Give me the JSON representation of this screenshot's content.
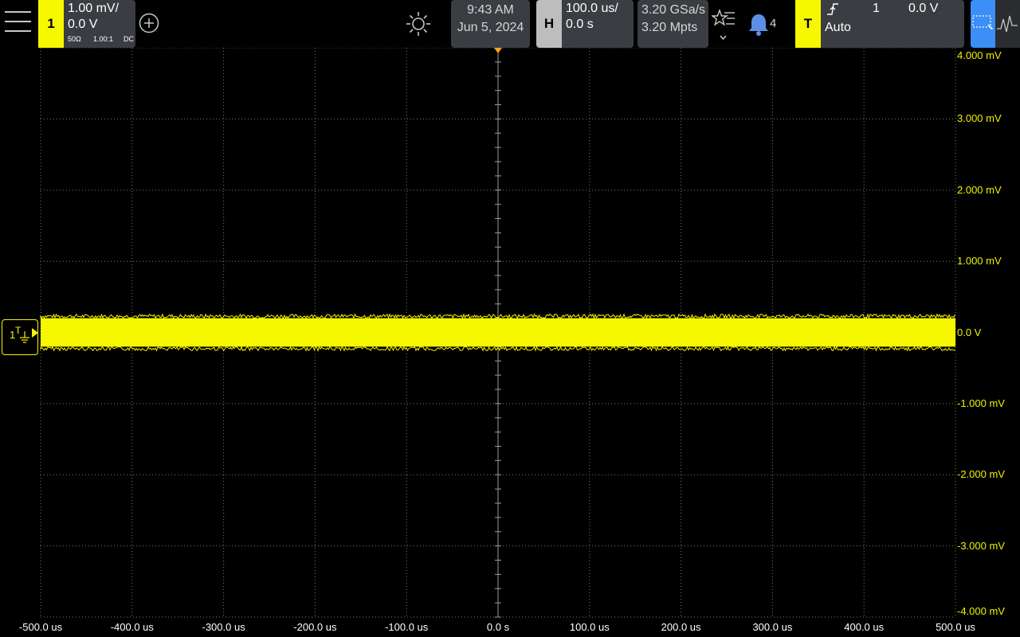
{
  "channel1": {
    "number": "1",
    "scale": "1.00 mV/",
    "offset": "0.0 V",
    "impedance": "50Ω",
    "probe": "1.00:1",
    "coupling": "DC"
  },
  "datetime": {
    "time": "9:43 AM",
    "date": "Jun 5, 2024"
  },
  "horizontal": {
    "badge": "H",
    "scale": "100.0 us/",
    "position": "0.0 s"
  },
  "acquisition": {
    "sample_rate": "3.20 GSa/s",
    "memory_depth": "3.20 Mpts"
  },
  "notifications": {
    "count": "4"
  },
  "trigger": {
    "badge": "T",
    "source": "1",
    "level": "0.0 V",
    "mode": "Auto"
  },
  "ground_marker": {
    "channel": "1",
    "symbol": "T"
  },
  "colors": {
    "channel1": "#f7f700",
    "accent": "#3b8ff6",
    "panel": "#3a3d42",
    "trigger_marker": "#ff9d1e"
  },
  "icons": [
    "menu-icon",
    "add-channel-icon",
    "brightness-icon",
    "favorites-icon",
    "bell-icon",
    "trigger-edge-icon",
    "zoom-box-icon",
    "waveform-icon"
  ],
  "chart_data": {
    "type": "line",
    "y_unit": "mV",
    "y_ticks": [
      "4.000 mV",
      "3.000 mV",
      "2.000 mV",
      "1.000 mV",
      "0.0 V",
      "-1.000 mV",
      "-2.000 mV",
      "-3.000 mV",
      "-4.000 mV"
    ],
    "x_ticks": [
      "-500.0 us",
      "-400.0 us",
      "-300.0 us",
      "-200.0 us",
      "-100.0 us",
      "0.0 s",
      "100.0 us",
      "200.0 us",
      "300.0 us",
      "400.0 us",
      "500.0 us"
    ],
    "xlim": [
      -500,
      500
    ],
    "ylim": [
      -4,
      4
    ],
    "series": [
      {
        "center": 0.0,
        "band": [
          -0.2,
          0.2
        ]
      }
    ],
    "grid": "dotted"
  }
}
